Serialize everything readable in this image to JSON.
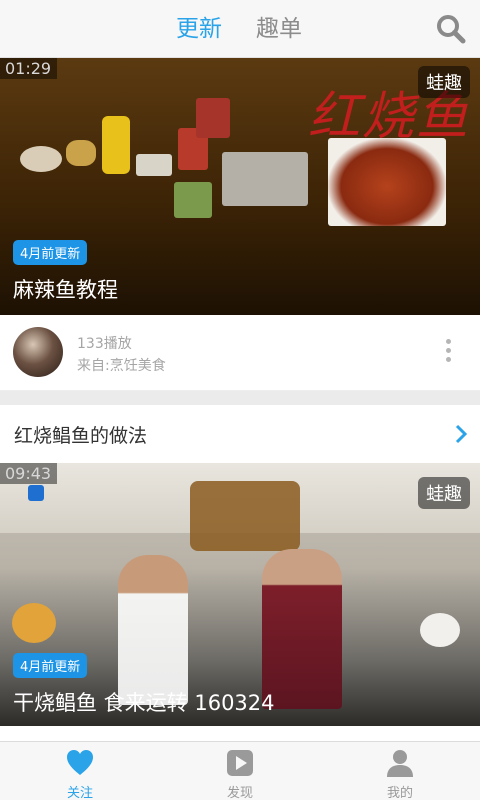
{
  "header": {
    "tabs": [
      {
        "label": "更新",
        "active": true
      },
      {
        "label": "趣单",
        "active": false
      }
    ],
    "search_icon": "search-icon",
    "accent_color": "#2aa3e8"
  },
  "feed": {
    "video1": {
      "duration": "01:29",
      "badge": "蛙趣",
      "update_label": "4月前更新",
      "title": "麻辣鱼教程",
      "play_count": "133播放",
      "source": "来自:烹饪美食"
    },
    "section": {
      "title": "红烧鲳鱼的做法"
    },
    "video2": {
      "duration": "09:43",
      "badge": "蛙趣",
      "update_label": "4月前更新",
      "title": "干烧鲳鱼 食来运转 160324"
    }
  },
  "bottom_nav": {
    "items": [
      {
        "label": "关注",
        "icon": "heart-icon",
        "active": true
      },
      {
        "label": "发现",
        "icon": "play-icon",
        "active": false
      },
      {
        "label": "我的",
        "icon": "user-icon",
        "active": false
      }
    ]
  }
}
